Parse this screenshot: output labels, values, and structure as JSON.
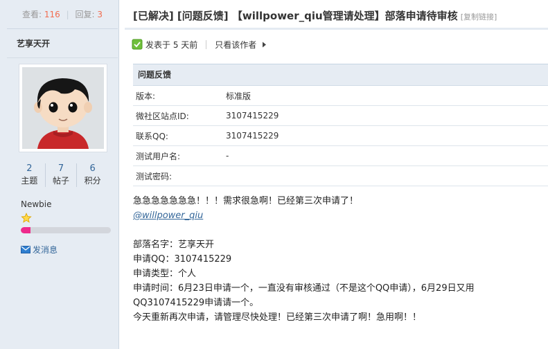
{
  "sidebar": {
    "views_label": "查看:",
    "views": "116",
    "replies_label": "回复:",
    "replies": "3",
    "author_name": "艺享天开",
    "stats": [
      {
        "value": "2",
        "label": "主题"
      },
      {
        "value": "7",
        "label": "帖子"
      },
      {
        "value": "6",
        "label": "积分"
      }
    ],
    "group": "Newbie",
    "level_progress": 0.11,
    "send_message": "发消息"
  },
  "post": {
    "title": "[已解决] [问题反馈] 【willpower_qiu管理请处理】部落申请待审核",
    "copy_link": "[复制链接]",
    "posted": "发表于 5 天前",
    "author_only": "只看该作者"
  },
  "info_table": {
    "header": "问题反馈",
    "rows": [
      {
        "key": "版本:",
        "value": "标准版"
      },
      {
        "key": "微社区站点ID:",
        "value": "3107415229"
      },
      {
        "key": "联系QQ:",
        "value": "3107415229"
      },
      {
        "key": "测试用户名:",
        "value": "-"
      },
      {
        "key": "测试密码:",
        "value": ""
      }
    ]
  },
  "content": {
    "line1": "急急急急急急急！！！需求很急啊！已经第三次申请了！",
    "mention": "@willpower_qiu",
    "line3": "部落名字：艺享天开",
    "line4": "申请QQ：3107415229",
    "line5": "申请类型：个人",
    "line6": "申请时间：6月23日申请一个，一直没有审核通过（不是这个QQ申请），6月29日又用",
    "line7": "QQ3107415229申请请一个。",
    "line8": "今天重新再次申请，请管理尽快处理！已经第三次申请了啊！急用啊！！"
  },
  "colors": {
    "accent": "#336699",
    "count": "#f26c4f",
    "progress": "#ee2a8c",
    "sidebar_bg": "#e6ecf3"
  },
  "icons": [
    "avatar-cartoon",
    "star-icon",
    "mail-icon",
    "online-status-icon",
    "arrow-right-icon"
  ]
}
